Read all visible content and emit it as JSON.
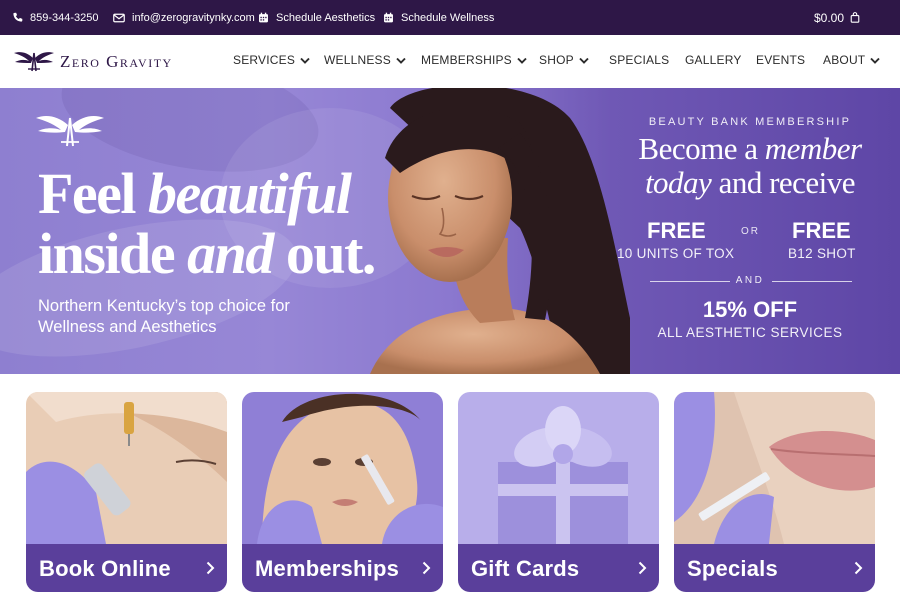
{
  "topbar": {
    "phone": "859-344-3250",
    "email": "info@zerogravitynky.com",
    "schedule_aesthetics": "Schedule Aesthetics",
    "schedule_wellness": "Schedule Wellness",
    "cart_total": "$0.00"
  },
  "logo": {
    "text": "Zero Gravity"
  },
  "nav": [
    {
      "label": "SERVICES",
      "dropdown": true
    },
    {
      "label": "WELLNESS",
      "dropdown": true
    },
    {
      "label": "MEMBERSHIPS",
      "dropdown": true
    },
    {
      "label": "SHOP",
      "dropdown": true
    },
    {
      "label": "SPECIALS",
      "dropdown": false
    },
    {
      "label": "GALLERY",
      "dropdown": false
    },
    {
      "label": "EVENTS",
      "dropdown": false
    },
    {
      "label": "ABOUT",
      "dropdown": true
    }
  ],
  "hero": {
    "headline_1a": "Feel ",
    "headline_1b": "beautiful",
    "headline_2a": "inside ",
    "headline_2b": "and",
    "headline_2c": " out.",
    "subtitle": "Northern Kentucky’s top choice for Wellness and Aesthetics"
  },
  "promo": {
    "eyebrow": "BEAUTY BANK MEMBERSHIP",
    "line1a": "Become a ",
    "line1b": "member",
    "line2a": "today",
    "line2b": " and receive",
    "free_left": "FREE",
    "free_left_sub": "10 UNITS OF TOX",
    "or": "OR",
    "free_right": "FREE",
    "free_right_sub": "B12 SHOT",
    "and": "AND",
    "discount": "15% OFF",
    "discount_sub": "ALL AESTHETIC SERVICES"
  },
  "cards": [
    {
      "label": "Book Online"
    },
    {
      "label": "Memberships"
    },
    {
      "label": "Gift Cards"
    },
    {
      "label": "Specials"
    }
  ],
  "colors": {
    "topbar": "#2e1747",
    "brand_purple": "#5a3f9b",
    "hero_light": "#9787d6",
    "hero_dark": "#5e46a6",
    "glove": "#9b8fe3"
  }
}
